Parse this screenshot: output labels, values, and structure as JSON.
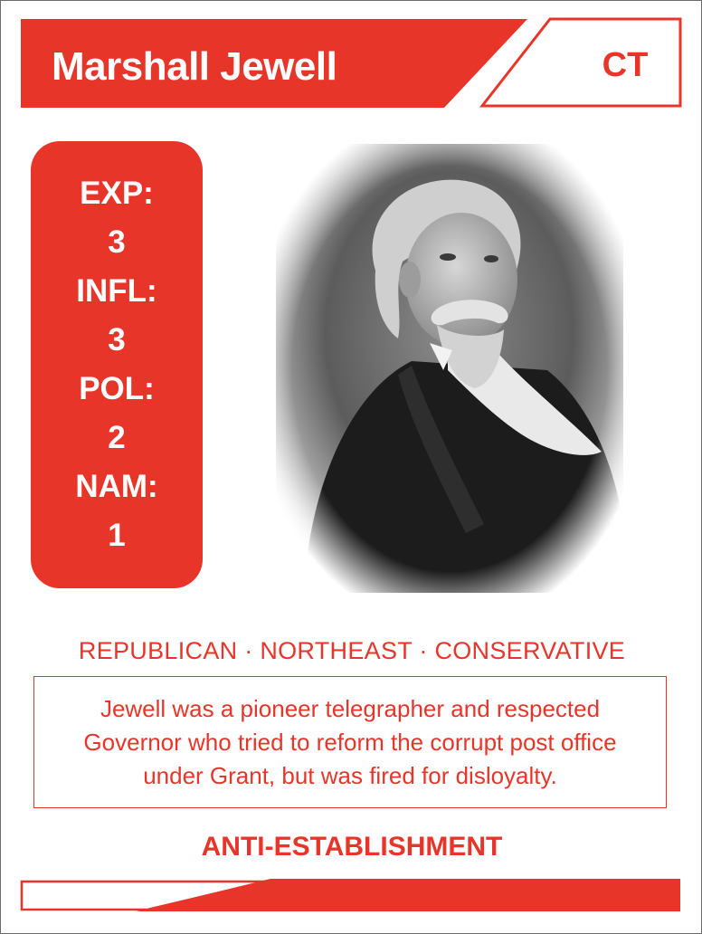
{
  "card": {
    "name": "Marshall Jewell",
    "state": "CT",
    "stats": [
      {
        "label": "EXP:",
        "value": "3"
      },
      {
        "label": "INFL:",
        "value": "3"
      },
      {
        "label": "POL:",
        "value": "2"
      },
      {
        "label": "NAM:",
        "value": "1"
      }
    ],
    "tags": "REPUBLICAN · NORTHEAST · CONSERVATIVE",
    "description": "Jewell was a pioneer telegrapher and respected Governor who tried to reform the corrupt post office under Grant, but was fired for disloyalty.",
    "trait": "ANTI-ESTABLISHMENT"
  },
  "colors": {
    "accent": "#e8352a",
    "background": "#ffffff",
    "text_on_accent": "#ffffff"
  }
}
